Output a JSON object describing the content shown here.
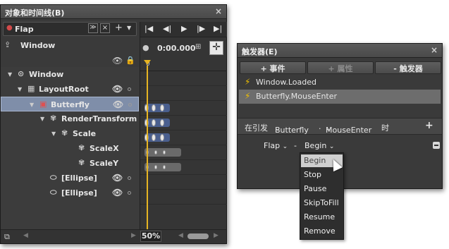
{
  "left_panel": {
    "title": "对象和时间线(B)",
    "close": "×",
    "storyboard_name": "Flap",
    "window_label": "Window",
    "time_display": "0:00.000",
    "ruler_zero": "0",
    "zoom": "50%",
    "tree": [
      {
        "label": "Window",
        "indent": 0,
        "icon": "window-icon"
      },
      {
        "label": "LayoutRoot",
        "indent": 1,
        "icon": "grid-icon"
      },
      {
        "label": "Butterfly",
        "indent": 2,
        "icon": "canvas-icon"
      },
      {
        "label": "RenderTransform",
        "indent": 3,
        "icon": "transform-icon"
      },
      {
        "label": "Scale",
        "indent": 4,
        "icon": "transform-icon"
      },
      {
        "label": "ScaleX",
        "indent": 5,
        "icon": "transform-icon"
      },
      {
        "label": "ScaleY",
        "indent": 5,
        "icon": "transform-icon"
      },
      {
        "label": "[Ellipse]",
        "indent": 3,
        "icon": "ellipse-icon"
      },
      {
        "label": "[Ellipse]",
        "indent": 3,
        "icon": "ellipse-icon"
      }
    ]
  },
  "right_panel": {
    "title": "触发器(E)",
    "close": "×",
    "add_event": "+ 事件",
    "add_property": "+ 属性",
    "remove_trigger": "- 触发器",
    "triggers": [
      "Window.Loaded",
      "Butterfly.MouseEnter"
    ],
    "when_prefix": "在引发",
    "when_object": "Butterfly",
    "dot": ".",
    "when_event": "MouseEnter",
    "when_suffix": "时",
    "add_action": "+",
    "action_storyboard": "Flap",
    "dash": "-",
    "action_value": "Begin",
    "menu_items": [
      "Begin",
      "Stop",
      "Pause",
      "SkipToFill",
      "Resume",
      "Remove"
    ]
  },
  "colors": {
    "selection": "#7f8ea9",
    "playhead": "#e6b422",
    "keyframe": "#4a5f8e",
    "trigger_bolt": "#f0c000"
  }
}
